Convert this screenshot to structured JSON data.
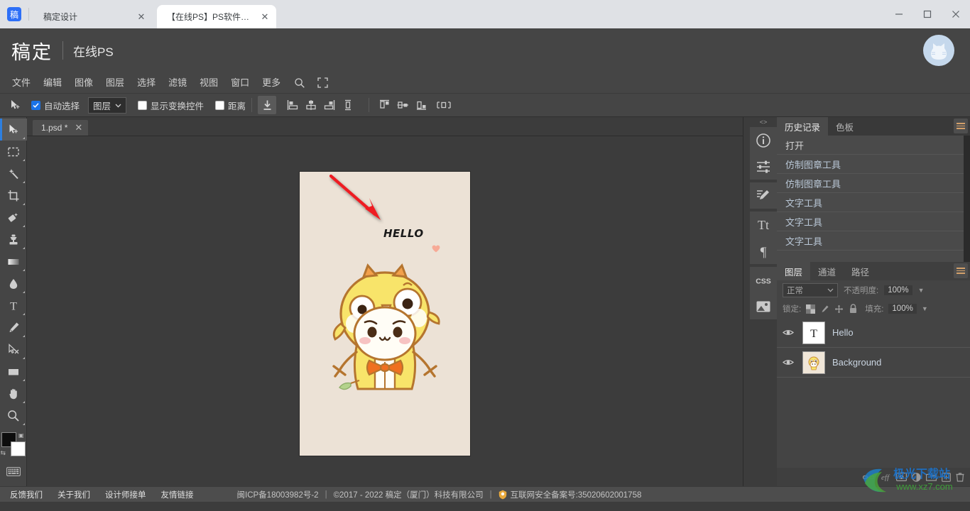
{
  "browser": {
    "brand_mark": "稿",
    "tabs": [
      {
        "label": "稿定设计",
        "active": false,
        "close_icon": "close-icon"
      },
      {
        "label": "【在线PS】PS软件网...",
        "active": true,
        "close_icon": "close-icon"
      }
    ],
    "window_controls": [
      {
        "name": "minimize",
        "glyph": "—"
      },
      {
        "name": "maximize",
        "glyph": "▢"
      },
      {
        "name": "close",
        "glyph": "✕"
      }
    ]
  },
  "app_header": {
    "logo": "稿定",
    "subtitle": "在线PS",
    "avatar_icon": "user-avatar-cat"
  },
  "menu_bar": {
    "items": [
      "文件",
      "编辑",
      "图像",
      "图层",
      "选择",
      "滤镜",
      "视图",
      "窗口",
      "更多"
    ],
    "icons": [
      {
        "name": "search-icon",
        "glyph": "search"
      },
      {
        "name": "fullscreen-icon",
        "glyph": "fullscreen"
      }
    ]
  },
  "options_bar": {
    "tool_icon": "move-tool-icon",
    "auto_select": {
      "label": "自动选择",
      "checked": true
    },
    "layer_dropdown": {
      "value": "图层"
    },
    "show_transform": {
      "label": "显示变换控件",
      "checked": false
    },
    "distance": {
      "label": "距离",
      "checked": false
    },
    "align_buttons": [
      "align-distribute-icon",
      "align-left-icon",
      "align-horizontal-center-icon",
      "align-right-icon",
      "align-vertical-distribute-icon",
      "align-top-icon",
      "align-middle-icon",
      "align-bottom-icon",
      "distribute-horizontal-icon"
    ]
  },
  "toolbar": {
    "tools": [
      {
        "name": "move-tool",
        "icon": "move-icon",
        "active": true
      },
      {
        "name": "marquee-tool",
        "icon": "rect-marquee-icon",
        "active": false
      },
      {
        "name": "magic-wand-tool",
        "icon": "magic-wand-icon",
        "active": false
      },
      {
        "name": "crop-tool",
        "icon": "crop-icon",
        "active": false
      },
      {
        "name": "patch-tool",
        "icon": "patch-icon",
        "active": false
      },
      {
        "name": "clone-stamp-tool",
        "icon": "stamp-icon",
        "active": false
      },
      {
        "name": "gradient-tool",
        "icon": "gradient-icon",
        "active": false
      },
      {
        "name": "blur-tool",
        "icon": "water-drop-icon",
        "active": false
      },
      {
        "name": "type-tool",
        "icon": "text-t-icon",
        "active": false
      },
      {
        "name": "pen-tool",
        "icon": "pen-icon",
        "active": false
      },
      {
        "name": "path-select-tool",
        "icon": "path-select-icon",
        "active": false
      },
      {
        "name": "shape-tool",
        "icon": "rectangle-icon",
        "active": false
      },
      {
        "name": "hand-tool",
        "icon": "hand-icon",
        "active": false
      },
      {
        "name": "zoom-tool",
        "icon": "magnifier-icon",
        "active": false
      }
    ],
    "foreground_color": "#0d0d0d",
    "background_color": "#ffffff",
    "keyboard_icon": "keyboard-icon"
  },
  "document": {
    "tab_label": "1.psd *",
    "close_icon": "close-icon",
    "canvas": {
      "background_color": "#ece2d6",
      "text_layer": "HELLO",
      "annotation": "red-arrow",
      "decoration": "pink-heart",
      "illustration": "cartoon-cat-in-chick-costume"
    }
  },
  "right_dock": {
    "icons": [
      {
        "name": "info-panel-icon",
        "glyph": "i"
      },
      {
        "name": "adjustments-panel-icon",
        "glyph": "sliders"
      },
      {
        "name": "brush-panel-icon",
        "glyph": "brush"
      },
      {
        "name": "character-panel-icon",
        "glyph": "Tt"
      },
      {
        "name": "paragraph-panel-icon",
        "glyph": "¶"
      },
      {
        "name": "css-panel-icon",
        "glyph": "CSS"
      },
      {
        "name": "image-panel-icon",
        "glyph": "image"
      }
    ],
    "history_panel": {
      "tabs": [
        {
          "label": "历史记录",
          "active": true
        },
        {
          "label": "色板",
          "active": false
        }
      ],
      "menu_icon": "panel-menu-icon",
      "items": [
        "打开",
        "仿制图章工具",
        "仿制图章工具",
        "文字工具",
        "文字工具",
        "文字工具"
      ]
    },
    "layers_panel": {
      "tabs": [
        {
          "label": "图层",
          "active": true
        },
        {
          "label": "通道",
          "active": false
        },
        {
          "label": "路径",
          "active": false
        }
      ],
      "menu_icon": "panel-menu-icon",
      "blend_mode": "正常",
      "opacity_label": "不透明度:",
      "opacity_value": "100%",
      "lock_label": "锁定:",
      "lock_icons": [
        "lock-transparent-pixels-icon",
        "lock-image-pixels-icon",
        "lock-position-icon",
        "lock-all-icon"
      ],
      "fill_label": "填充:",
      "fill_value": "100%",
      "layers": [
        {
          "name": "Hello",
          "thumb": "text-layer-thumb",
          "visible": true
        },
        {
          "name": "Background",
          "thumb": "image-layer-thumb",
          "visible": true
        }
      ],
      "footer_icons": [
        "link-layers-icon",
        "layer-effects-icon",
        "layer-mask-icon",
        "adjustment-layer-icon",
        "new-group-icon",
        "new-layer-icon",
        "delete-layer-icon"
      ]
    }
  },
  "watermark": {
    "brand": "极光下载站",
    "url": "www.xz7.com"
  },
  "footer": {
    "links": [
      "反馈我们",
      "关于我们",
      "设计师接单",
      "友情链接"
    ],
    "icp": "闽ICP备18003982号-2",
    "copyright": "©2017 - 2022 稿定（厦门）科技有限公司",
    "police_badge_icon": "police-badge-icon",
    "police": "互联网安全备案号:35020602001758",
    "separator": "|"
  }
}
